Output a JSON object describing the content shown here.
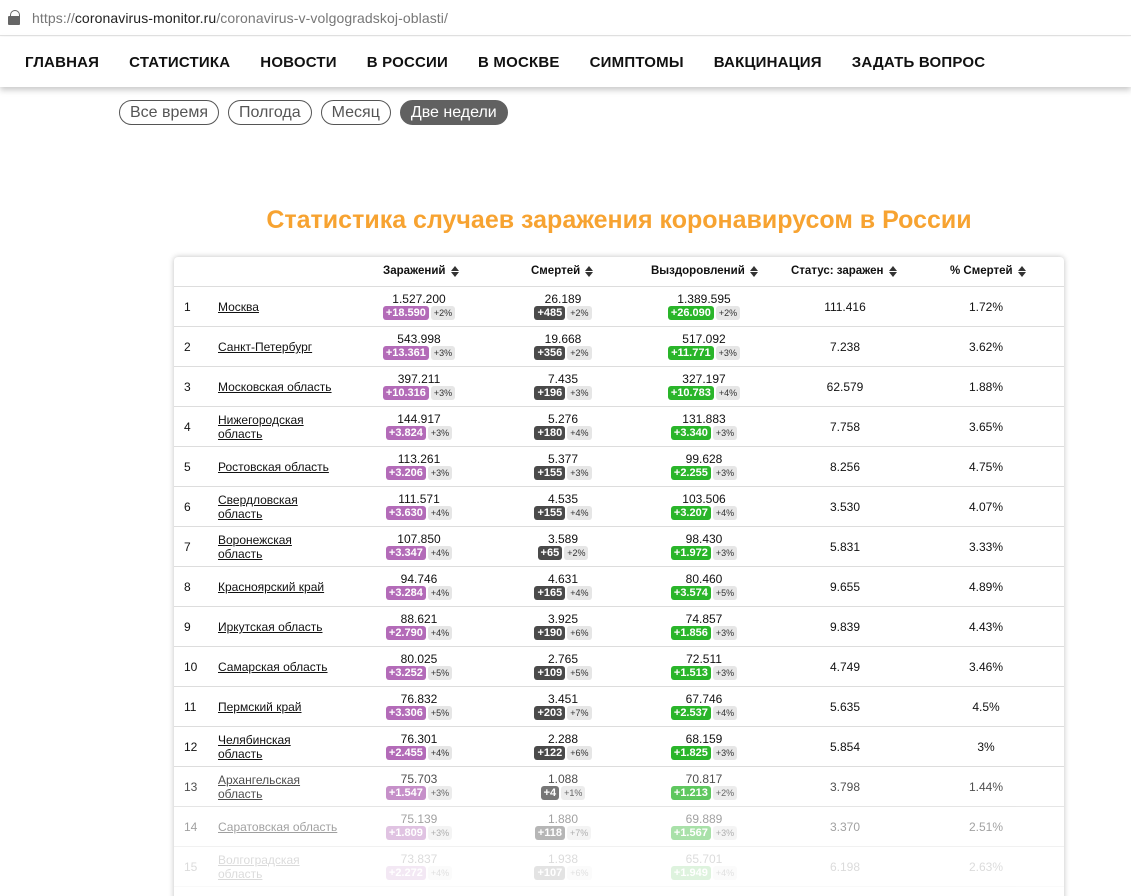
{
  "browser": {
    "url_scheme": "https://",
    "url_host": "coronavirus-monitor.ru",
    "url_path": "/coronavirus-v-volgogradskoj-oblasti/"
  },
  "nav": [
    "ГЛАВНАЯ",
    "СТАТИСТИКА",
    "НОВОСТИ",
    "В РОССИИ",
    "В МОСКВЕ",
    "СИМПТОМЫ",
    "ВАКЦИНАЦИЯ",
    "ЗАДАТЬ ВОПРОС"
  ],
  "filters": [
    {
      "label": "Все время",
      "active": false
    },
    {
      "label": "Полгода",
      "active": false
    },
    {
      "label": "Месяц",
      "active": false
    },
    {
      "label": "Две недели",
      "active": true
    }
  ],
  "title": "Статистика случаев заражения коронавирусом в России",
  "columns": {
    "infected": "Заражений",
    "deaths": "Смертей",
    "recovered": "Выздоровлений",
    "active": "Статус: заражен",
    "mortality": "% Смертей"
  },
  "colors": {
    "title": "#f7a331",
    "infected_badge": "#b36bb8",
    "deaths_badge": "#4a4a4a",
    "recovered_badge": "#2ab52a"
  },
  "rows": [
    {
      "n": "1",
      "region": "Москва",
      "inf": "1.527.200",
      "inf_d": "+18.590",
      "inf_p": "+2%",
      "dth": "26.189",
      "dth_d": "+485",
      "dth_p": "+2%",
      "rec": "1.389.595",
      "rec_d": "+26.090",
      "rec_p": "+2%",
      "active": "111.416",
      "mort": "1.72%"
    },
    {
      "n": "2",
      "region": "Санкт-Петербург",
      "inf": "543.998",
      "inf_d": "+13.361",
      "inf_p": "+3%",
      "dth": "19.668",
      "dth_d": "+356",
      "dth_p": "+2%",
      "rec": "517.092",
      "rec_d": "+11.771",
      "rec_p": "+3%",
      "active": "7.238",
      "mort": "3.62%"
    },
    {
      "n": "3",
      "region": "Московская область",
      "inf": "397.211",
      "inf_d": "+10.316",
      "inf_p": "+3%",
      "dth": "7.435",
      "dth_d": "+196",
      "dth_p": "+3%",
      "rec": "327.197",
      "rec_d": "+10.783",
      "rec_p": "+4%",
      "active": "62.579",
      "mort": "1.88%"
    },
    {
      "n": "4",
      "region": "Нижегородская область",
      "inf": "144.917",
      "inf_d": "+3.824",
      "inf_p": "+3%",
      "dth": "5.276",
      "dth_d": "+180",
      "dth_p": "+4%",
      "rec": "131.883",
      "rec_d": "+3.340",
      "rec_p": "+3%",
      "active": "7.758",
      "mort": "3.65%"
    },
    {
      "n": "5",
      "region": "Ростовская область",
      "inf": "113.261",
      "inf_d": "+3.206",
      "inf_p": "+3%",
      "dth": "5.377",
      "dth_d": "+155",
      "dth_p": "+3%",
      "rec": "99.628",
      "rec_d": "+2.255",
      "rec_p": "+3%",
      "active": "8.256",
      "mort": "4.75%"
    },
    {
      "n": "6",
      "region": "Свердловская область",
      "inf": "111.571",
      "inf_d": "+3.630",
      "inf_p": "+4%",
      "dth": "4.535",
      "dth_d": "+155",
      "dth_p": "+4%",
      "rec": "103.506",
      "rec_d": "+3.207",
      "rec_p": "+4%",
      "active": "3.530",
      "mort": "4.07%"
    },
    {
      "n": "7",
      "region": "Воронежская область",
      "inf": "107.850",
      "inf_d": "+3.347",
      "inf_p": "+4%",
      "dth": "3.589",
      "dth_d": "+65",
      "dth_p": "+2%",
      "rec": "98.430",
      "rec_d": "+1.972",
      "rec_p": "+3%",
      "active": "5.831",
      "mort": "3.33%"
    },
    {
      "n": "8",
      "region": "Красноярский край",
      "inf": "94.746",
      "inf_d": "+3.284",
      "inf_p": "+4%",
      "dth": "4.631",
      "dth_d": "+165",
      "dth_p": "+4%",
      "rec": "80.460",
      "rec_d": "+3.574",
      "rec_p": "+5%",
      "active": "9.655",
      "mort": "4.89%"
    },
    {
      "n": "9",
      "region": "Иркутская область",
      "inf": "88.621",
      "inf_d": "+2.790",
      "inf_p": "+4%",
      "dth": "3.925",
      "dth_d": "+190",
      "dth_p": "+6%",
      "rec": "74.857",
      "rec_d": "+1.856",
      "rec_p": "+3%",
      "active": "9.839",
      "mort": "4.43%"
    },
    {
      "n": "10",
      "region": "Самарская область",
      "inf": "80.025",
      "inf_d": "+3.252",
      "inf_p": "+5%",
      "dth": "2.765",
      "dth_d": "+109",
      "dth_p": "+5%",
      "rec": "72.511",
      "rec_d": "+1.513",
      "rec_p": "+3%",
      "active": "4.749",
      "mort": "3.46%"
    },
    {
      "n": "11",
      "region": "Пермский край",
      "inf": "76.832",
      "inf_d": "+3.306",
      "inf_p": "+5%",
      "dth": "3.451",
      "dth_d": "+203",
      "dth_p": "+7%",
      "rec": "67.746",
      "rec_d": "+2.537",
      "rec_p": "+4%",
      "active": "5.635",
      "mort": "4.5%"
    },
    {
      "n": "12",
      "region": "Челябинская область",
      "inf": "76.301",
      "inf_d": "+2.455",
      "inf_p": "+4%",
      "dth": "2.288",
      "dth_d": "+122",
      "dth_p": "+6%",
      "rec": "68.159",
      "rec_d": "+1.825",
      "rec_p": "+3%",
      "active": "5.854",
      "mort": "3%"
    },
    {
      "n": "13",
      "region": "Архангельская область",
      "inf": "75.703",
      "inf_d": "+1.547",
      "inf_p": "+3%",
      "dth": "1.088",
      "dth_d": "+4",
      "dth_p": "+1%",
      "rec": "70.817",
      "rec_d": "+1.213",
      "rec_p": "+2%",
      "active": "3.798",
      "mort": "1.44%"
    },
    {
      "n": "14",
      "region": "Саратовская область",
      "inf": "75.139",
      "inf_d": "+1.809",
      "inf_p": "+3%",
      "dth": "1.880",
      "dth_d": "+118",
      "dth_p": "+7%",
      "rec": "69.889",
      "rec_d": "+1.567",
      "rec_p": "+3%",
      "active": "3.370",
      "mort": "2.51%"
    },
    {
      "n": "15",
      "region": "Волгоградская область",
      "inf": "73.837",
      "inf_d": "+2.272",
      "inf_p": "+4%",
      "dth": "1.938",
      "dth_d": "+107",
      "dth_p": "+6%",
      "rec": "65.701",
      "rec_d": "+1.949",
      "rec_p": "+4%",
      "active": "6.198",
      "mort": "2.63%"
    }
  ]
}
